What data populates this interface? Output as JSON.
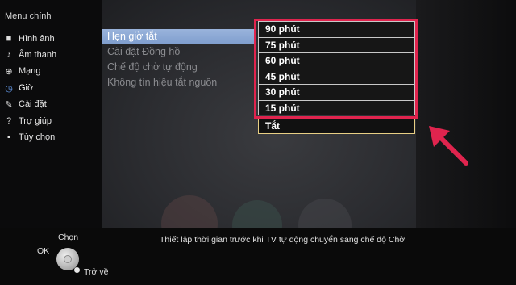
{
  "sidebar": {
    "title": "Menu chính",
    "items": [
      {
        "label": "Hình ảnh",
        "icon": "picture-icon"
      },
      {
        "label": "Âm thanh",
        "icon": "music-note-icon"
      },
      {
        "label": "Mạng",
        "icon": "globe-icon"
      },
      {
        "label": "Giờ",
        "icon": "clock-icon"
      },
      {
        "label": "Cài đặt",
        "icon": "wrench-icon"
      },
      {
        "label": "Trợ giúp",
        "icon": "question-icon"
      },
      {
        "label": "Tùy chọn",
        "icon": "box-icon"
      }
    ],
    "active": "Giờ"
  },
  "submenu": {
    "items": [
      {
        "label": "Hẹn giờ tắt"
      },
      {
        "label": "Cài đặt Đồng hồ"
      },
      {
        "label": "Chế độ chờ tự động"
      },
      {
        "label": "Không tín hiệu tắt nguồn"
      }
    ],
    "selected": "Hẹn giờ tắt"
  },
  "options": {
    "items": [
      {
        "label": "90 phút"
      },
      {
        "label": "75 phút"
      },
      {
        "label": "60 phút"
      },
      {
        "label": "45 phút"
      },
      {
        "label": "30 phút"
      },
      {
        "label": "15 phút"
      },
      {
        "label": "Tắt"
      }
    ],
    "focused": "Tắt"
  },
  "bottom": {
    "help_text": "Thiết lập thời gian trước khi TV tự động chuyển sang chế độ Chờ",
    "select_label": "Chọn",
    "ok_label": "OK",
    "back_label": "Trở về"
  },
  "colors": {
    "highlight_box": "#e0244e",
    "selected_item": "#8aa7d4",
    "focus_border": "#e8cf84"
  }
}
